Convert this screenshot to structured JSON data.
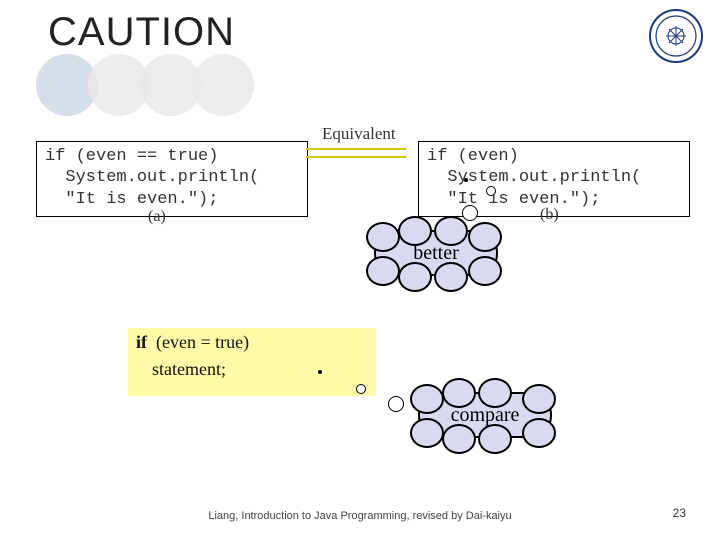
{
  "title": "CAUTION",
  "codeA": "if (even == true)\n  System.out.println(\n  \"It is even.\");",
  "codeB": "if (even)\n  System.out.println(\n  \"It is even.\");",
  "captionA": "(a)",
  "captionB": "(b)",
  "equivLabel": "Equivalent",
  "cloudBetter": "better",
  "cloudCompare": "compare",
  "snippet": {
    "keyword": "if",
    "cond": "(even = true)",
    "stmt": "statement;"
  },
  "footer": "Liang, Introduction to Java Programming, revised by Dai-kaiyu",
  "pageNum": "23"
}
